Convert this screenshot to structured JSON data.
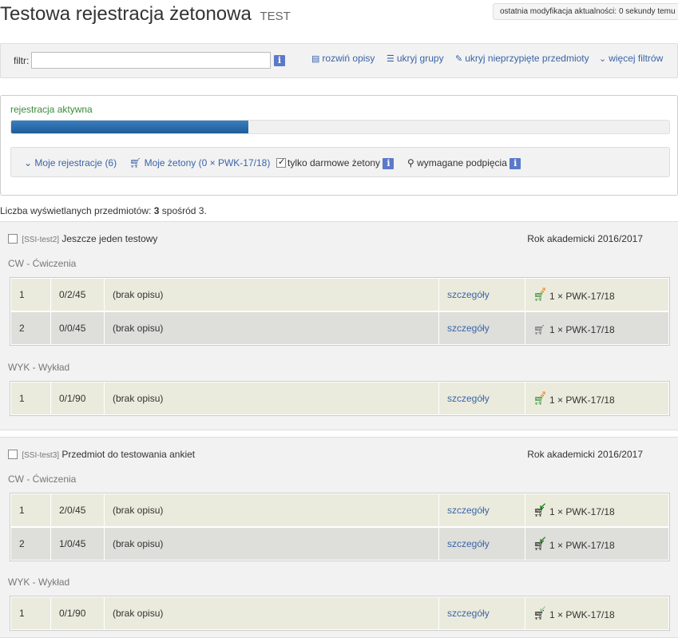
{
  "header": {
    "title": "Testowa rejestracja żetonowa",
    "tag": "TEST",
    "last_modified": "ostatnia modyfikacja aktualności: 0 sekundy temu"
  },
  "filter_bar": {
    "label": "filtr:",
    "input_value": "",
    "info_icon": "i",
    "links": {
      "expand": "rozwiń opisy",
      "hide_groups": "ukryj grupy",
      "hide_unassigned": "ukryj nieprzypięte przedmioty",
      "more_filters": "więcej filtrów"
    }
  },
  "registration": {
    "status": "rejestracja aktywna",
    "progress_fraction": 0.36,
    "my_registrations": "Moje rejestracje (6)",
    "my_tokens": "Moje żetony (0 × PWK-17/18)",
    "free_tokens": "tylko darmowe żetony",
    "free_tokens_checked": true,
    "required_links": "wymagane podpięcia"
  },
  "count": {
    "prefix": "Liczba wyświetlanych przedmiotów: ",
    "shown": "3",
    "suffix": " spośród 3."
  },
  "courses": [
    {
      "code": "[SSI-test2]",
      "name": "Jeszcze jeden testowy",
      "year": "Rok akademicki 2016/2017",
      "groups": [
        {
          "title": "CW - Ćwiczenia",
          "rows": [
            {
              "num": "1",
              "cap": "0/2/45",
              "desc": "(brak opisu)",
              "link": "szczegóły",
              "token": "1 × PWK-17/18",
              "icon": "cart-add-icon"
            },
            {
              "num": "2",
              "cap": "0/0/45",
              "desc": "(brak opisu)",
              "link": "szczegóły",
              "token": "1 × PWK-17/18",
              "icon": "cart-disabled-icon"
            }
          ]
        },
        {
          "title": "WYK - Wykład",
          "rows": [
            {
              "num": "1",
              "cap": "0/1/90",
              "desc": "(brak opisu)",
              "link": "szczegóły",
              "token": "1 × PWK-17/18",
              "icon": "cart-add-icon"
            }
          ]
        }
      ]
    },
    {
      "code": "[SSI-test3]",
      "name": "Przedmiot do testowania ankiet",
      "year": "Rok akademicki 2016/2017",
      "groups": [
        {
          "title": "CW - Ćwiczenia",
          "rows": [
            {
              "num": "1",
              "cap": "2/0/45",
              "desc": "(brak opisu)",
              "link": "szczegóły",
              "token": "1 × PWK-17/18",
              "icon": "cart-remove-icon"
            },
            {
              "num": "2",
              "cap": "1/0/45",
              "desc": "(brak opisu)",
              "link": "szczegóły",
              "token": "1 × PWK-17/18",
              "icon": "cart-remove-icon"
            }
          ]
        },
        {
          "title": "WYK - Wykład",
          "rows": [
            {
              "num": "1",
              "cap": "0/1/90",
              "desc": "(brak opisu)",
              "link": "szczegóły",
              "token": "1 × PWK-17/18",
              "icon": "cart-remove-light-icon"
            }
          ]
        }
      ]
    }
  ]
}
